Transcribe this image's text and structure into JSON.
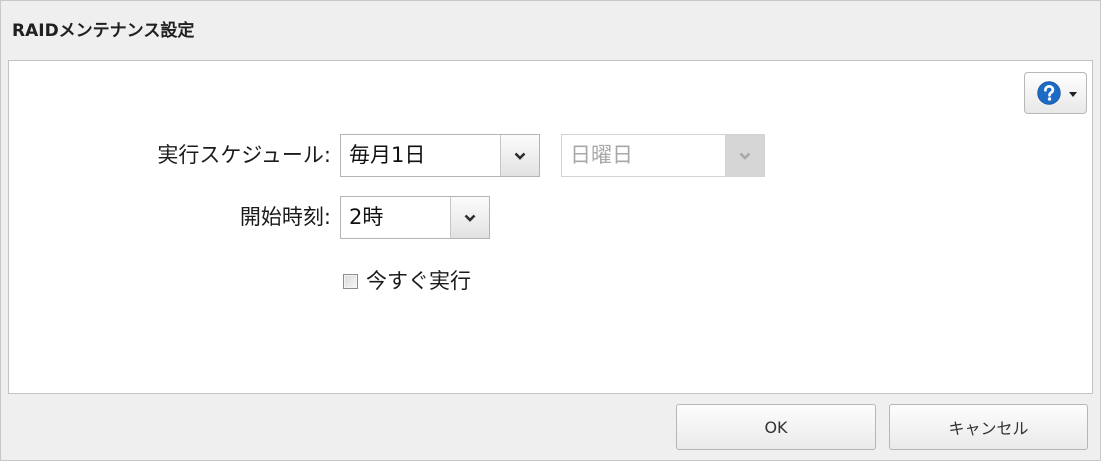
{
  "dialog": {
    "title": "RAIDメンテナンス設定"
  },
  "help": {
    "icon": "help-icon",
    "menu_icon": "caret-down-icon",
    "accent": "#1c6cc6"
  },
  "form": {
    "schedule": {
      "label": "実行スケジュール:",
      "value": "毎月1日",
      "icon": "chevron-down-icon"
    },
    "weekday": {
      "value": "日曜日",
      "disabled": true,
      "icon": "chevron-down-icon"
    },
    "start_time": {
      "label": "開始時刻:",
      "value": "2時",
      "icon": "chevron-down-icon"
    },
    "run_now": {
      "label": "今すぐ実行",
      "checked": false
    }
  },
  "footer": {
    "ok_label": "OK",
    "cancel_label": "キャンセル"
  }
}
